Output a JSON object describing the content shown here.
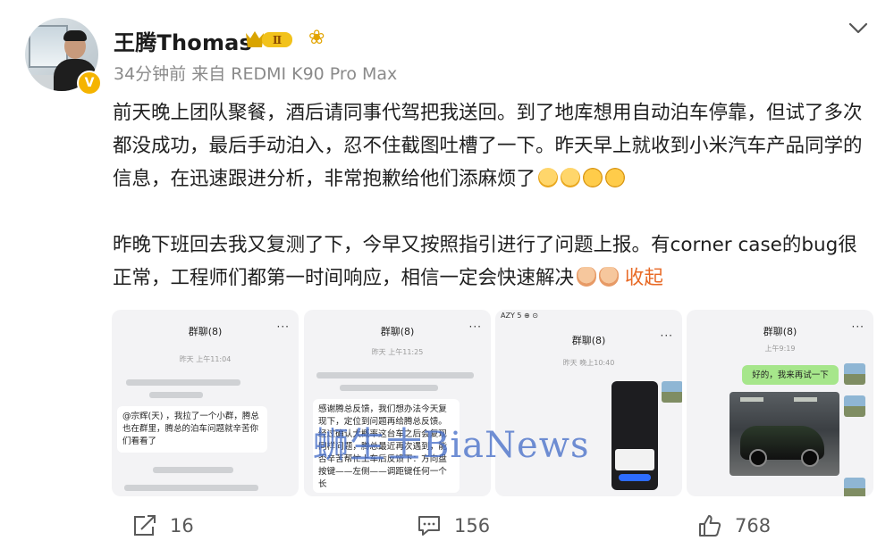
{
  "user": {
    "name": "王腾Thomas",
    "level_badge": "Ⅱ",
    "verified_badge": "V",
    "meta": "34分钟前  来自 REDMI K90 Pro Max"
  },
  "post": {
    "paragraph1": "前天晚上团队聚餐，酒后请同事代驾把我送回。到了地库想用自动泊车停靠，但试了多次都没成功，最后手动泊入，忍不住截图吐槽了一下。昨天早上就收到小米汽车产品同学的信息，在迅速跟进分析，非常抱歉给他们添麻烦了",
    "paragraph2": "昨晚下班回去我又复测了下，今早又按照指引进行了问题上报。有corner case的bug很正常，工程师们都第一时间响应，相信一定会快速解决",
    "collapse_label": "收起"
  },
  "images": [
    {
      "title": "群聊(8)",
      "time": "昨天 上午11:04",
      "message": "@宗辉(天) ，我拉了一个小群，腾总也在群里，腾总的泊车问题就辛苦你们看看了"
    },
    {
      "title": "群聊(8)",
      "time": "昨天 上午11:25",
      "message": "感谢腾总反馈，我们想办法今天复现下，定位到问题再给腾总反馈。经过确认大概率这台车之后会复现同样问题，腾总最近再次遇到，能否辛苦帮忙上车后反馈下：方向盘按键——左侧——调距键任何一个长"
    },
    {
      "title": "群聊(8)",
      "time": "昨天 晚上10:40",
      "status_top": "AZY 5 ⊕ ⊙"
    },
    {
      "title": "群聊(8)",
      "time": "上午9:19",
      "message": "好的，我来再试一下"
    }
  ],
  "watermark": "蛳生士BiaNews",
  "actions": {
    "share_count": "16",
    "comment_count": "156",
    "like_count": "768"
  },
  "colors": {
    "accent_orange": "#e86a26",
    "meta_gray": "#8a8a8a",
    "wechat_green": "#a6e68b"
  },
  "icons": [
    "chevron-down-icon",
    "share-icon",
    "comment-icon",
    "like-icon",
    "flower-icon",
    "verified-icon"
  ]
}
